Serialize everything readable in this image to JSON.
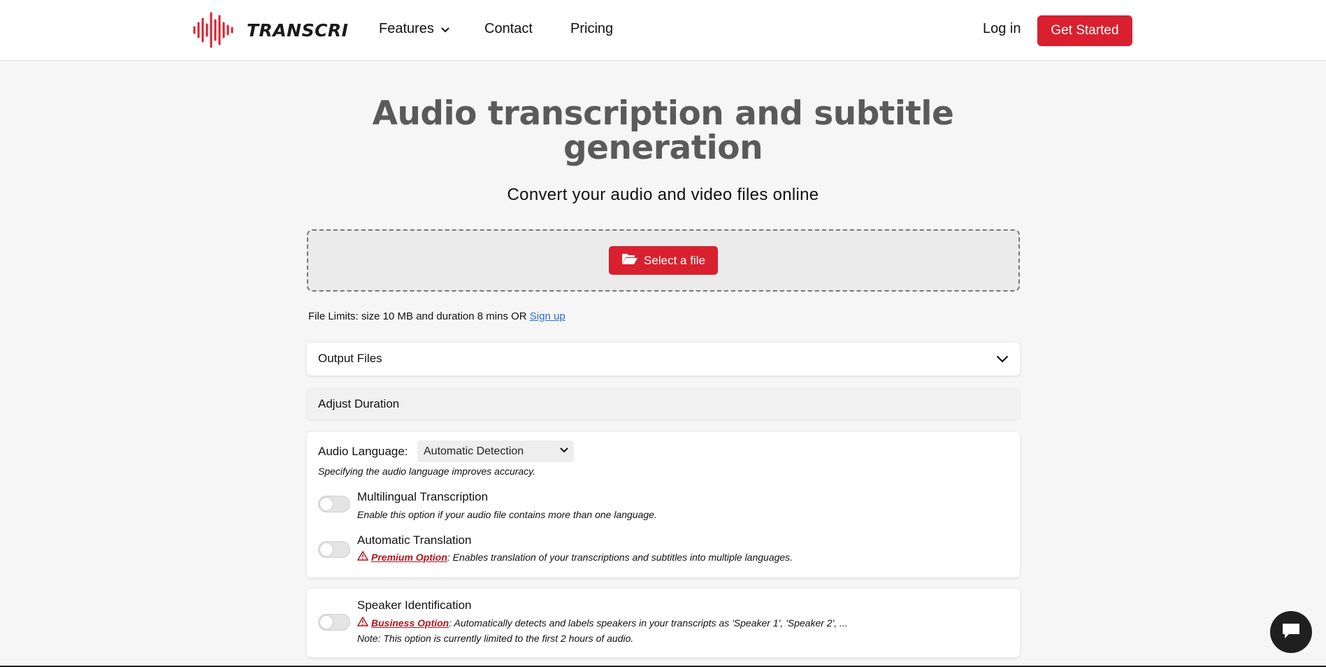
{
  "brand": {
    "name": "TRANSCRI",
    "accent": "#d9202f"
  },
  "nav": {
    "features": "Features",
    "contact": "Contact",
    "pricing": "Pricing",
    "login": "Log in",
    "get_started": "Get Started"
  },
  "hero": {
    "title": "Audio transcription and subtitle generation",
    "subtitle": "Convert your audio and video files online"
  },
  "upload": {
    "button": "Select a file",
    "limits_text": "File Limits: size 10 MB and duration 8 mins OR",
    "signup_link": "Sign up"
  },
  "sections": {
    "output_files": "Output Files",
    "adjust_duration": "Adjust Duration"
  },
  "language": {
    "label": "Audio Language:",
    "selected": "Automatic Detection",
    "hint": "Specifying the audio language improves accuracy."
  },
  "options": {
    "multilingual": {
      "title": "Multilingual Transcription",
      "desc": "Enable this option if your audio file contains more than one language.",
      "enabled": false
    },
    "translation": {
      "title": "Automatic Translation",
      "badge": "Premium Option",
      "desc": ": Enables translation of your transcriptions and subtitles into multiple languages.",
      "enabled": false
    },
    "speaker": {
      "title": "Speaker Identification",
      "badge": "Business Option",
      "desc": ": Automatically detects and labels speakers in your transcripts as 'Speaker 1', 'Speaker 2', ...",
      "note": "Note: This option is currently limited to the first 2 hours of audio.",
      "enabled": false
    }
  },
  "icons": {
    "logo": "waveform-icon",
    "features_chevron": "chevron-down-icon",
    "folder": "folder-open-icon",
    "panel_chevron": "chevron-down-icon",
    "warning": "warning-triangle-icon",
    "chat": "chat-bubble-icon"
  }
}
